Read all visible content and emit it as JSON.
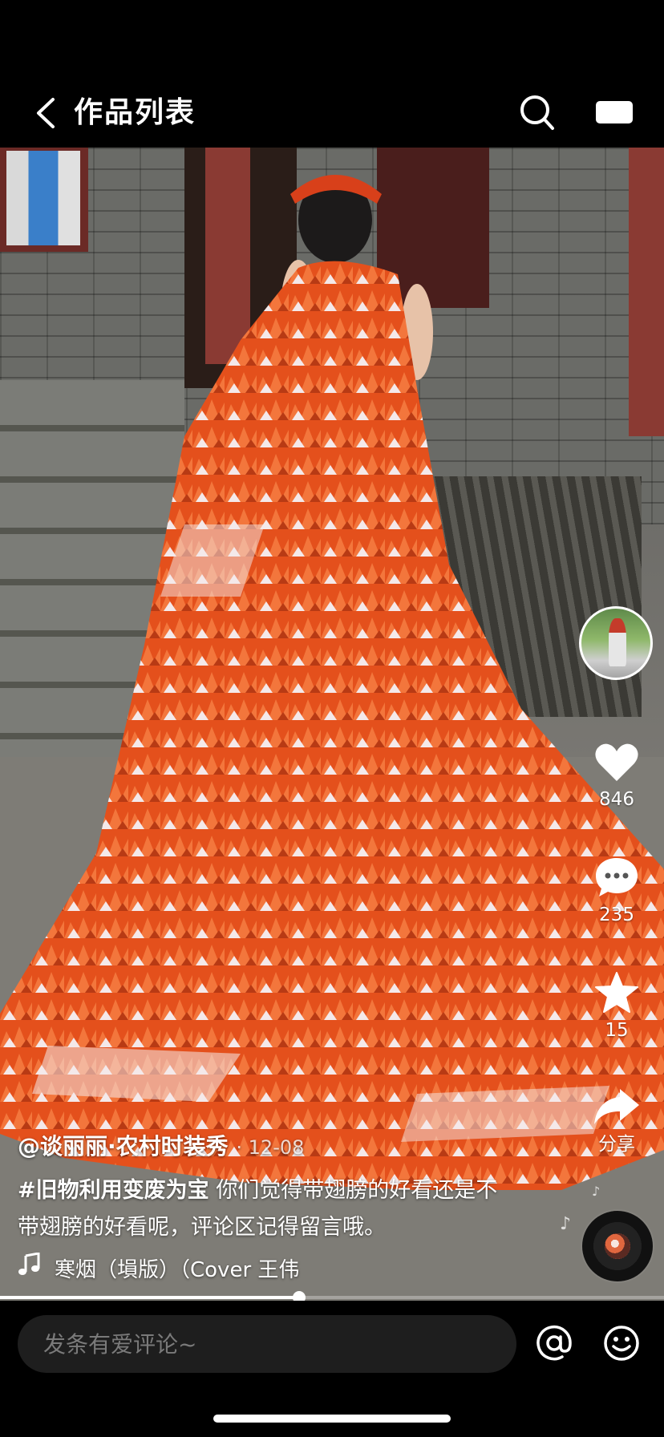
{
  "header": {
    "title": "作品列表",
    "back_icon": "chevron-left-icon",
    "search_icon": "search-icon",
    "cast_icon": "screen-cast-icon"
  },
  "video": {
    "subject": "orange-dress-photo"
  },
  "actions": {
    "like_count": "846",
    "comment_count": "235",
    "favorite_count": "15",
    "share_label": "分享"
  },
  "caption": {
    "author": "@谈丽丽·农村时装秀",
    "date": "· 12-08",
    "hashtag": "#旧物利用变废为宝",
    "text": " 你们觉得带翅膀的好看还是不带翅膀的好看呢，评论区记得留言哦。"
  },
  "music": {
    "icon": "music-note-icon",
    "title": "寒烟（塤版）（Cover 王伟"
  },
  "player": {
    "progress": 0.45
  },
  "comment_bar": {
    "placeholder": "发条有爱评论~",
    "at_icon": "at-icon",
    "emoji_icon": "emoji-icon"
  },
  "colors": {
    "background": "#000000",
    "dress_orange": "#e8531e",
    "input_bg": "#1e1e1e"
  }
}
